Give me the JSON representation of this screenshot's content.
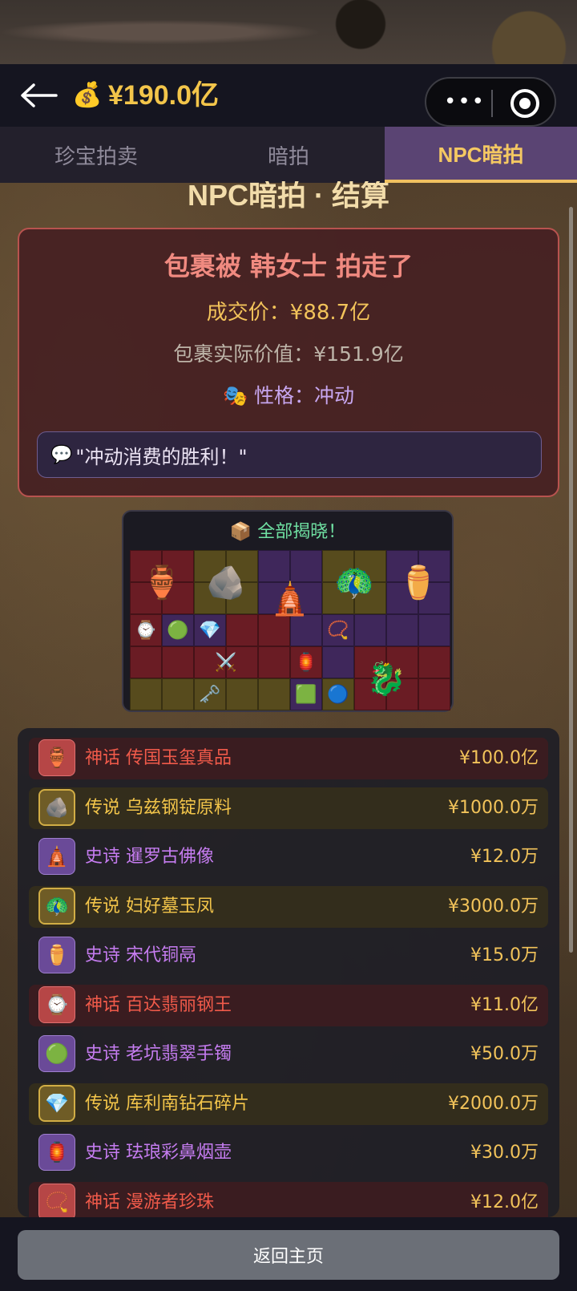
{
  "header": {
    "back_icon": "arrow-left-icon",
    "money_icon": "💰",
    "money": "¥190.0亿",
    "capsule_more_icon": "•••",
    "capsule_close_icon": "target-icon"
  },
  "tabs": [
    {
      "label": "珍宝拍卖",
      "active": false
    },
    {
      "label": "暗拍",
      "active": false
    },
    {
      "label": "NPC暗拍",
      "active": true
    }
  ],
  "section": {
    "icon": "🎭",
    "title": "NPC暗拍 · 结算"
  },
  "result": {
    "title": "包裹被 韩女士 拍走了",
    "deal_price": "成交价：¥88.7亿",
    "real_value": "包裹实际价值：¥151.9亿",
    "personality_icon": "🎭",
    "personality": "性格：冲动",
    "quote_icon": "💬",
    "quote": "\"冲动消费的胜利！\""
  },
  "reveal": {
    "icon": "📦",
    "title": "全部揭晓！",
    "items": [
      "🏺",
      "🪨",
      "🛕",
      "🦚",
      "⚱️",
      "⌚",
      "🟢",
      "💎",
      "📿",
      "🏮",
      "⚔️",
      "🗝️",
      "🟩",
      "🔵",
      "🐉"
    ]
  },
  "items": [
    {
      "rarity": "神话",
      "name": "传国玉玺真品",
      "price": "¥100.0亿",
      "tier": "myth",
      "icon": "🏺"
    },
    {
      "rarity": "传说",
      "name": "乌兹钢锭原料",
      "price": "¥1000.0万",
      "tier": "legend",
      "icon": "🪨"
    },
    {
      "rarity": "史诗",
      "name": "暹罗古佛像",
      "price": "¥12.0万",
      "tier": "epic",
      "icon": "🛕"
    },
    {
      "rarity": "传说",
      "name": "妇好墓玉凤",
      "price": "¥3000.0万",
      "tier": "legend",
      "icon": "🦚"
    },
    {
      "rarity": "史诗",
      "name": "宋代铜鬲",
      "price": "¥15.0万",
      "tier": "epic",
      "icon": "⚱️"
    },
    {
      "rarity": "神话",
      "name": "百达翡丽钢王",
      "price": "¥11.0亿",
      "tier": "myth",
      "icon": "⌚"
    },
    {
      "rarity": "史诗",
      "name": "老坑翡翠手镯",
      "price": "¥50.0万",
      "tier": "epic",
      "icon": "🟢"
    },
    {
      "rarity": "传说",
      "name": "库利南钻石碎片",
      "price": "¥2000.0万",
      "tier": "legend",
      "icon": "💎"
    },
    {
      "rarity": "史诗",
      "name": "珐琅彩鼻烟壶",
      "price": "¥30.0万",
      "tier": "epic",
      "icon": "🏮"
    },
    {
      "rarity": "神话",
      "name": "漫游者珍珠",
      "price": "¥12.0亿",
      "tier": "myth",
      "icon": "📿"
    }
  ],
  "footer": {
    "home_label": "返回主页"
  }
}
